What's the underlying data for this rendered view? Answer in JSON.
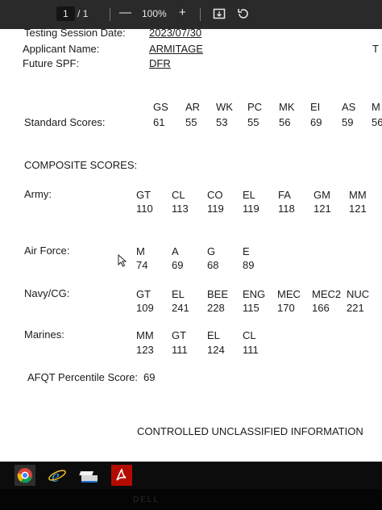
{
  "toolbar": {
    "page_current": "1",
    "page_sep": "/",
    "page_total": "1",
    "zoom_out": "—",
    "zoom": "100%",
    "zoom_in": "+"
  },
  "doc": {
    "session_label": "Testing Session Date:",
    "session_value": "2023/07/30",
    "applicant_label": "Applicant Name:",
    "applicant_value": "ARMITAGE",
    "spf_label": "Future SPF:",
    "spf_value": "DFR",
    "cut_right_glyph": "T",
    "standard": {
      "label": "Standard Scores:",
      "headers": [
        "GS",
        "AR",
        "WK",
        "PC",
        "MK",
        "EI",
        "AS",
        "M"
      ],
      "values": [
        "61",
        "55",
        "53",
        "55",
        "56",
        "69",
        "59",
        "56"
      ]
    },
    "composite_title": "COMPOSITE SCORES:",
    "army": {
      "label": "Army:",
      "headers": [
        "GT",
        "CL",
        "CO",
        "EL",
        "FA",
        "GM",
        "MM"
      ],
      "values": [
        "110",
        "113",
        "119",
        "119",
        "118",
        "121",
        "121"
      ]
    },
    "airforce": {
      "label": "Air Force:",
      "headers": [
        "M",
        "A",
        "G",
        "E"
      ],
      "values": [
        "74",
        "69",
        "68",
        "89"
      ]
    },
    "navy": {
      "label": "Navy/CG:",
      "headers": [
        "GT",
        "EL",
        "BEE",
        "ENG",
        "MEC",
        "MEC2",
        "NUC"
      ],
      "values": [
        "109",
        "241",
        "228",
        "115",
        "170",
        "166",
        "221"
      ]
    },
    "marines": {
      "label": "Marines:",
      "headers": [
        "MM",
        "GT",
        "EL",
        "CL"
      ],
      "values": [
        "123",
        "111",
        "124",
        "111"
      ]
    },
    "afqt_label": "AFQT Percentile Score:",
    "afqt_value": "69",
    "footer": "CONTROLLED UNCLASSIFIED INFORMATION"
  },
  "taskbar": {
    "apps": [
      "chrome-icon",
      "internet-explorer-icon",
      "scanner-icon",
      "acrobat-icon"
    ]
  },
  "bezel": {
    "logo": "DELL"
  }
}
